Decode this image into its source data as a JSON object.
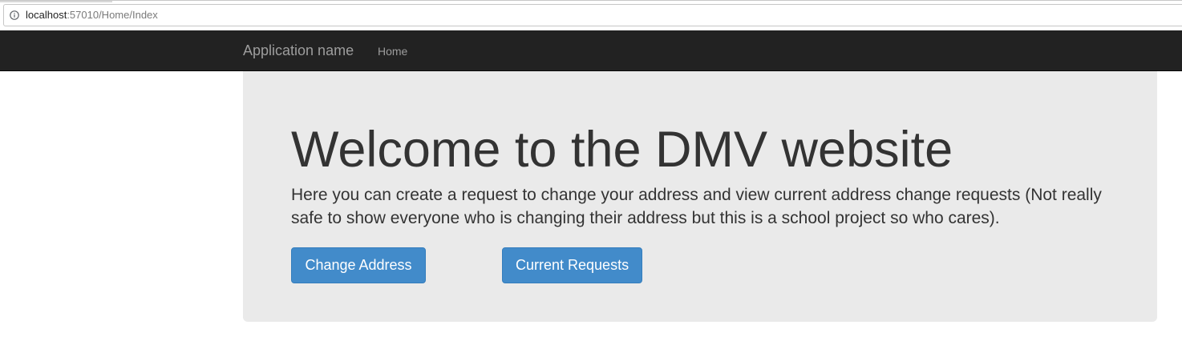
{
  "browser": {
    "url_host": "localhost",
    "url_rest": ":57010/Home/Index",
    "info_icon": "info-circle-icon"
  },
  "navbar": {
    "brand": "Application name",
    "links": [
      {
        "label": "Home"
      }
    ],
    "background": "#222222",
    "link_color": "#9d9d9d"
  },
  "jumbotron": {
    "title": "Welcome to the DMV website",
    "lead": "Here you can create a request to change your address and view current address change requests (Not really safe to show everyone who is changing their address but this is a school project so who cares).",
    "background": "#eaeaea",
    "buttons": [
      {
        "label": "Change Address"
      },
      {
        "label": "Current Requests"
      }
    ],
    "button_color": "#428bca"
  }
}
